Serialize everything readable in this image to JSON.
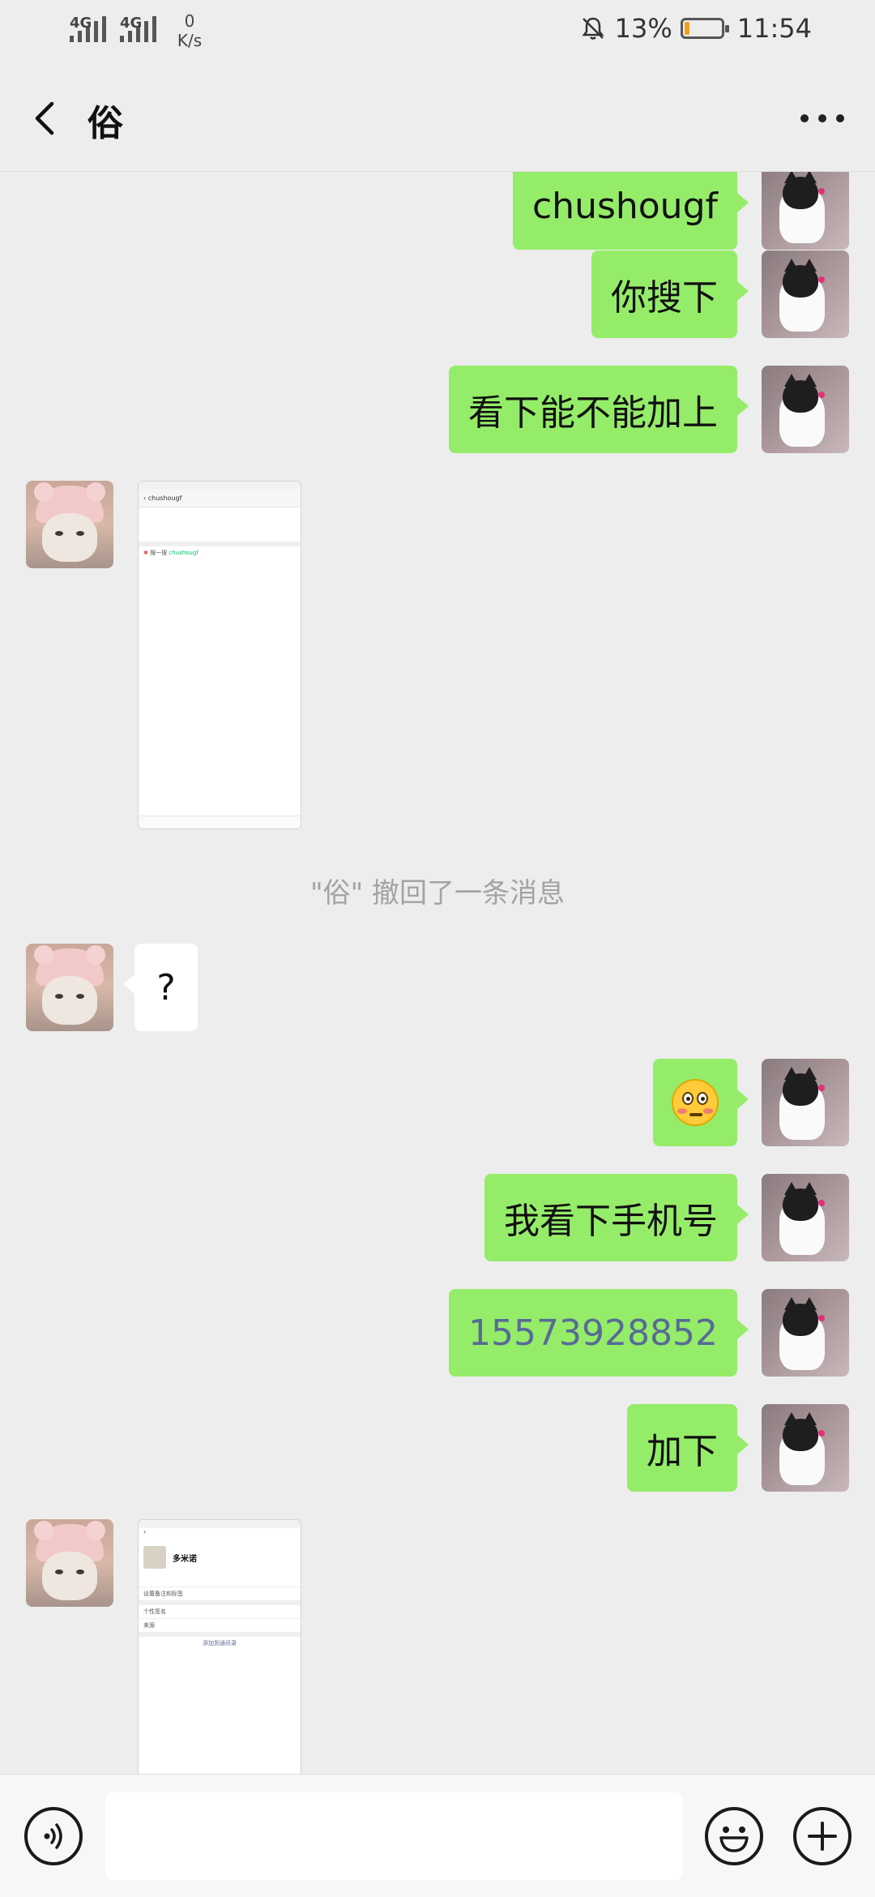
{
  "status_bar": {
    "network1": "4G",
    "network2": "4G",
    "speed_value": "0",
    "speed_unit": "K/s",
    "battery_percent": "13%",
    "battery_level": 0.13,
    "time": "11:54"
  },
  "header": {
    "title": "俗"
  },
  "messages": {
    "m1": "chushougf",
    "m2": "你搜下",
    "m3": "看下能不能加上",
    "recall_notice": "\"俗\" 撤回了一条消息",
    "m5": "?",
    "m7": "我看下手机号",
    "m8": "15573928852",
    "m9": "加下"
  },
  "screenshot1": {
    "title": "chushougf",
    "entry_name": "搜一搜",
    "entry_keyword": "chushougf"
  },
  "screenshot2": {
    "contact_name": "多米诺",
    "row1": "设置备注和标签",
    "row2_label": "个性签名",
    "row3_label": "来源",
    "add_button": "添加到通讯录"
  },
  "icons": {
    "back": "back-arrow-icon",
    "more": "more-dots-icon",
    "voice": "voice-icon",
    "emoji": "emoji-icon",
    "plus": "plus-icon",
    "emoji_message": "flushed-face-emoji"
  },
  "colors": {
    "bubble_me": "#95ec69",
    "bubble_other": "#ffffff",
    "background": "#ededed",
    "phone_link": "#576b95"
  }
}
